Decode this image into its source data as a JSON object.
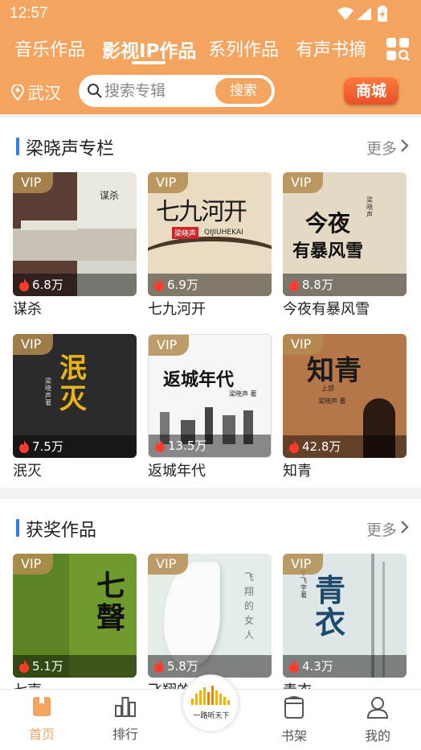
{
  "status": {
    "time": "12:57"
  },
  "tabs": [
    {
      "label": "音乐作品"
    },
    {
      "label": "影视IP作品"
    },
    {
      "label": "系列作品"
    },
    {
      "label": "有声书摘"
    }
  ],
  "location": {
    "city": "武汉"
  },
  "search": {
    "placeholder": "搜索专辑",
    "button": "搜索"
  },
  "mall": {
    "label": "商城"
  },
  "sections": [
    {
      "title": "梁晓声专栏",
      "more": "更多",
      "items": [
        {
          "badge": "VIP",
          "plays": "6.8万",
          "title": "谋杀",
          "cover_text": "谋杀"
        },
        {
          "badge": "VIP",
          "plays": "6.9万",
          "title": "七九河开",
          "cover_text": "七九河开",
          "cover_sub": "QIJIUHEKAI",
          "cover_tag": "梁晓声"
        },
        {
          "badge": "VIP",
          "plays": "8.8万",
          "title": "今夜有暴风雪",
          "cover_text": "今夜",
          "cover_text2": "有暴风雪",
          "cover_tag": "梁晓声"
        },
        {
          "badge": "VIP",
          "plays": "7.5万",
          "title": "泯灭",
          "cover_text": "泯灭",
          "cover_tag": "梁晓声 著"
        },
        {
          "badge": "VIP",
          "plays": "13.5万",
          "title": "返城年代",
          "cover_text": "返城年代",
          "cover_tag": "梁晓声 著"
        },
        {
          "badge": "VIP",
          "plays": "42.8万",
          "title": "知青",
          "cover_text": "知青",
          "cover_sub": "上部",
          "cover_tag": "梁晓声 著"
        }
      ]
    },
    {
      "title": "获奖作品",
      "more": "更多",
      "items": [
        {
          "badge": "VIP",
          "plays": "5.1万",
          "title": "七声",
          "cover_text": "七聲"
        },
        {
          "badge": "VIP",
          "plays": "5.8万",
          "title": "飞翔的",
          "cover_text": "飞翔的女人"
        },
        {
          "badge": "VIP",
          "plays": "4.3万",
          "title": "青衣",
          "cover_text": "青衣",
          "cover_tag": "毕飞宇 著"
        }
      ]
    }
  ],
  "nav": [
    {
      "label": "首页"
    },
    {
      "label": "排行"
    },
    {
      "label": "书架"
    },
    {
      "label": "我的"
    }
  ],
  "center_logo": {
    "text": "一路听天下"
  },
  "colors": {
    "brand": "#f4a45f",
    "accent_blue": "#2d7ff0",
    "mall": "#e8502a"
  }
}
